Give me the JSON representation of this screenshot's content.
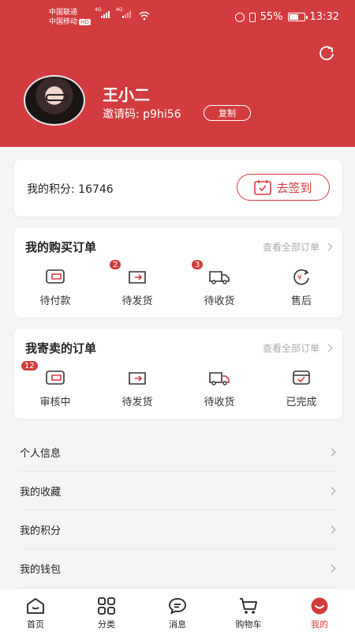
{
  "status": {
    "carrier1": "中国联通",
    "carrier2": "中国移动",
    "hd": "HD",
    "sig1": "4G",
    "sig2": "4G",
    "battery": "55%",
    "time": "13:32"
  },
  "profile": {
    "name": "王小二",
    "invite_label": "邀请码: p9hi56",
    "copy_label": "复制"
  },
  "points": {
    "text": "我的积分: 16746",
    "signin_label": "去签到"
  },
  "buy_orders": {
    "title": "我的购买订单",
    "view_all": "查看全部订单",
    "items": [
      {
        "label": "待付款",
        "icon": "wallet-icon",
        "badge": ""
      },
      {
        "label": "待发货",
        "icon": "ship-icon",
        "badge": "2"
      },
      {
        "label": "待收货",
        "icon": "truck-icon",
        "badge": "3"
      },
      {
        "label": "售后",
        "icon": "refund-icon",
        "badge": ""
      }
    ]
  },
  "sell_orders": {
    "title": "我寄卖的订单",
    "view_all": "查看全部订单",
    "items": [
      {
        "label": "审核中",
        "icon": "review-icon",
        "badge": "12"
      },
      {
        "label": "待发货",
        "icon": "ship-icon",
        "badge": ""
      },
      {
        "label": "待收货",
        "icon": "truck-icon",
        "badge": ""
      },
      {
        "label": "已完成",
        "icon": "completed-icon",
        "badge": ""
      }
    ]
  },
  "menu": [
    {
      "label": "个人信息"
    },
    {
      "label": "我的收藏"
    },
    {
      "label": "我的积分"
    },
    {
      "label": "我的钱包"
    }
  ],
  "tabs": [
    {
      "label": "首页",
      "icon": "home-icon"
    },
    {
      "label": "分类",
      "icon": "category-icon"
    },
    {
      "label": "消息",
      "icon": "message-icon"
    },
    {
      "label": "购物车",
      "icon": "cart-icon"
    },
    {
      "label": "我的",
      "icon": "profile-icon"
    }
  ],
  "colors": {
    "accent": "#d23c3f"
  }
}
